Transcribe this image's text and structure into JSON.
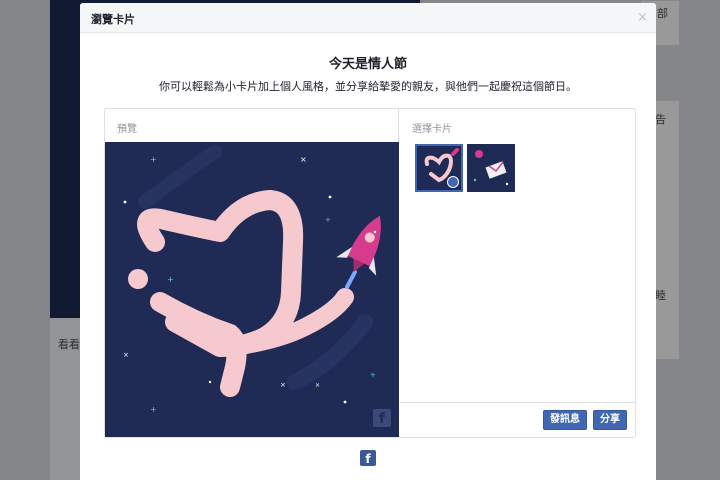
{
  "background": {
    "feed_text": "看看",
    "right_labels": [
      "部",
      "告",
      "睦"
    ]
  },
  "dialog": {
    "title": "瀏覽卡片",
    "close": "×",
    "headline": "今天是情人節",
    "subline": "你可以輕鬆為小卡片加上個人風格，並分享給摯愛的親友，與他們一起慶祝這個節日。",
    "preview_label": "預覽",
    "choose_label": "選擇卡片",
    "send_button": "發訊息",
    "share_button": "分享",
    "fb_glyph": "f"
  },
  "colors": {
    "card_bg": "#1f2b54",
    "heart_trail": "#f6c9cf",
    "rocket": "#d63c8e",
    "fb_blue": "#4267b2"
  }
}
